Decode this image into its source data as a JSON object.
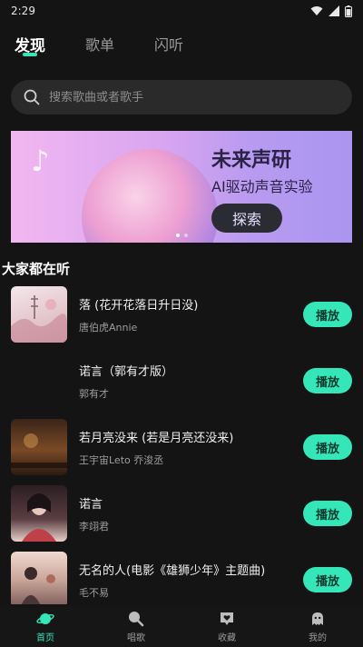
{
  "status_bar": {
    "time": "2:29"
  },
  "tabs": [
    {
      "label": "发现",
      "active": true
    },
    {
      "label": "歌单",
      "active": false
    },
    {
      "label": "闪听",
      "active": false
    }
  ],
  "search": {
    "placeholder": "搜索歌曲或者歌手"
  },
  "banner": {
    "title": "未来声研",
    "subtitle": "AI驱动声音实验",
    "button_label": "探索",
    "slide_count": 2,
    "active_slide": 1
  },
  "section": {
    "title": "大家都在听"
  },
  "songs": [
    {
      "title": "落 (花开花落日升日没)",
      "artist": "唐伯虎Annie",
      "button": "播放"
    },
    {
      "title": "诺言（郭有才版）",
      "artist": "郭有才",
      "button": "播放"
    },
    {
      "title": "若月亮没来 (若是月亮还没来)",
      "artist": "王宇宙Leto 乔浚丞",
      "button": "播放"
    },
    {
      "title": "诺言",
      "artist": "李翊君",
      "button": "播放"
    },
    {
      "title": "无名的人(电影《雄狮少年》主题曲)",
      "artist": "毛不易",
      "button": "播放"
    }
  ],
  "bottom_nav": [
    {
      "label": "首页",
      "icon": "planet-icon",
      "active": true
    },
    {
      "label": "唱歌",
      "icon": "mic-icon",
      "active": false
    },
    {
      "label": "收藏",
      "icon": "heart-box-icon",
      "active": false
    },
    {
      "label": "我的",
      "icon": "ghost-icon",
      "active": false
    }
  ],
  "colors": {
    "accent": "#35e6b8",
    "background": "#141414"
  }
}
